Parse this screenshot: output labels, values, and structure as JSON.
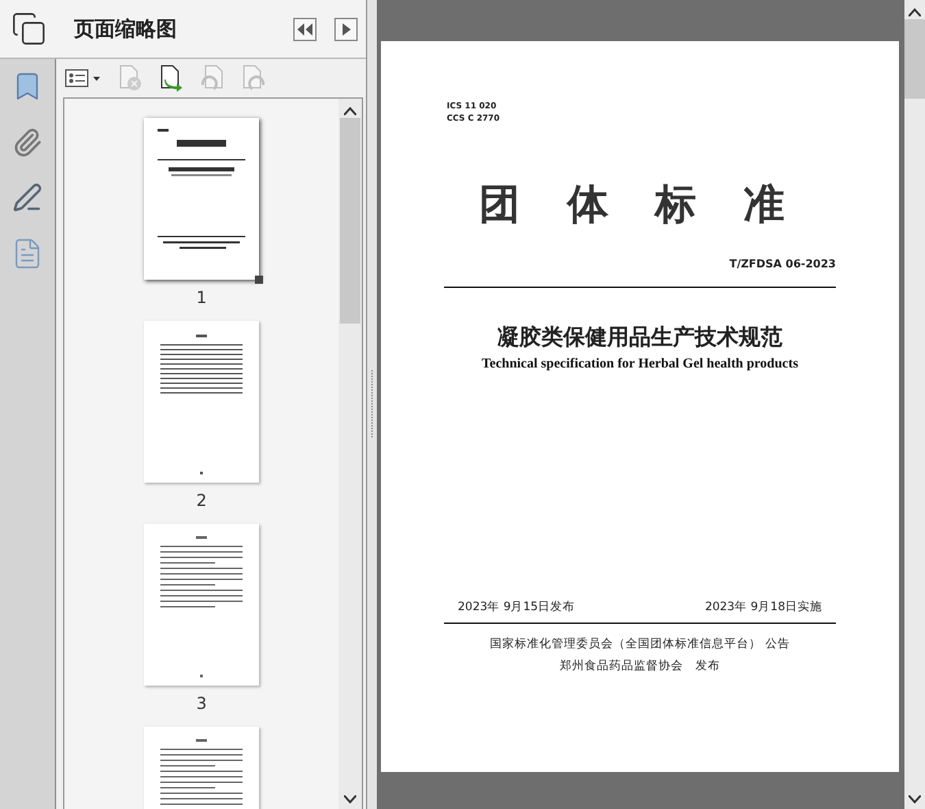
{
  "panel": {
    "title": "页面缩略图"
  },
  "toolbar": [
    {
      "kind": "options",
      "disabled": false
    },
    {
      "kind": "delete",
      "disabled": true
    },
    {
      "kind": "insert",
      "disabled": false
    },
    {
      "kind": "rotate-left",
      "disabled": true
    },
    {
      "kind": "rotate-right",
      "disabled": true
    }
  ],
  "thumbnails": [
    {
      "label": "1",
      "kind": "cover",
      "selected": true
    },
    {
      "label": "2",
      "kind": "contents",
      "selected": false
    },
    {
      "label": "3",
      "kind": "text",
      "selected": false
    },
    {
      "kind": "text",
      "selected": false
    }
  ],
  "document": {
    "classification": [
      "ICS 11 020",
      "CCS C 2770"
    ],
    "heading": "团 体 标 准",
    "code": "T/ZFDSA 06-2023",
    "title": "凝胶类保健用品生产技术规范",
    "subtitle": "Technical specification for Herbal Gel health products",
    "issued": "2023年 9月15日发布",
    "effective": "2023年 9月18日实施",
    "publishers": [
      "国家标准化管理委员会（全国团体标准信息平台） 公告",
      "郑州食品药品监督协会　发布"
    ]
  }
}
